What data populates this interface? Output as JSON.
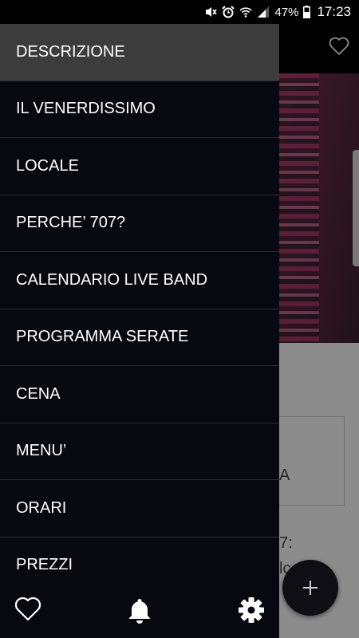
{
  "status_bar": {
    "battery": "47%",
    "time": "17:23"
  },
  "app": {
    "box_text": "A",
    "text_line1": "7:",
    "text_line2": "lc"
  },
  "drawer": {
    "items": [
      {
        "label": "DESCRIZIONE",
        "active": true
      },
      {
        "label": "IL VENERDISSIMO"
      },
      {
        "label": "LOCALE"
      },
      {
        "label": "PERCHE’ 707?"
      },
      {
        "label": "CALENDARIO LIVE BAND"
      },
      {
        "label": "PROGRAMMA SERATE"
      },
      {
        "label": "CENA"
      },
      {
        "label": "MENU’"
      },
      {
        "label": "ORARI"
      },
      {
        "label": "PREZZI"
      }
    ],
    "footer_icons": [
      "heart-icon",
      "bell-icon",
      "gear-icon"
    ]
  },
  "colors": {
    "drawer_bg": "#080810",
    "active_item_bg": "#3c3c3c",
    "text": "#ffffff"
  }
}
